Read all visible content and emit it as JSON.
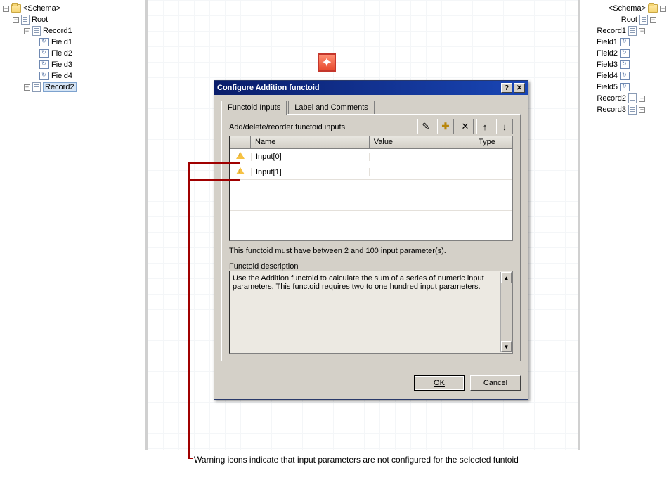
{
  "left_tree": {
    "schema": "<Schema>",
    "root": "Root",
    "record1": "Record1",
    "fields": [
      "Field1",
      "Field2",
      "Field3",
      "Field4"
    ],
    "record2": "Record2"
  },
  "right_tree": {
    "schema": "<Schema>",
    "root": "Root",
    "record1": "Record1",
    "fields": [
      "Field1",
      "Field2",
      "Field3",
      "Field4",
      "Field5"
    ],
    "record2": "Record2",
    "record3": "Record3"
  },
  "functoid_glyph": "✦",
  "dialog": {
    "title": "Configure Addition functoid",
    "tabs": {
      "inputs": "Functoid Inputs",
      "label": "Label and Comments"
    },
    "section": "Add/delete/reorder functoid inputs",
    "toolbar": {
      "edit": "✎",
      "add": "✚",
      "delete": "✕",
      "up": "↑",
      "down": "↓"
    },
    "columns": {
      "name": "Name",
      "value": "Value",
      "type": "Type"
    },
    "rows": [
      {
        "name": "Input[0]",
        "value": "",
        "type": ""
      },
      {
        "name": "Input[1]",
        "value": "",
        "type": ""
      }
    ],
    "hint": "This functoid must have between 2 and 100 input parameter(s).",
    "desc_label": "Functoid description",
    "description": "Use the Addition functoid to calculate the sum of a series of numeric input parameters. This functoid requires two to one hundred input parameters.",
    "ok": "OK",
    "cancel": "Cancel"
  },
  "caption": "Warning icons indicate that input parameters are not configured for the selected funtoid",
  "expanders": {
    "plus": "+",
    "minus": "−"
  },
  "win": {
    "help": "?",
    "close": "✕"
  }
}
